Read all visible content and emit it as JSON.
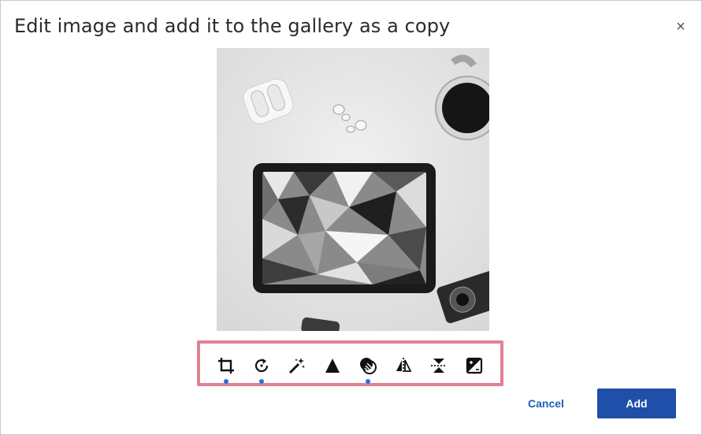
{
  "dialog": {
    "title": "Edit image and add it to the gallery as a copy",
    "close_label": "×"
  },
  "image": {
    "subject": "tablet-earbuds-coffee-flatlay"
  },
  "toolbar": {
    "tools": [
      {
        "icon": "crop-icon",
        "active": true
      },
      {
        "icon": "rotate-icon",
        "active": true
      },
      {
        "icon": "magic-wand-icon",
        "active": false
      },
      {
        "icon": "sharpen-triangle-icon",
        "active": false
      },
      {
        "icon": "filter-icon",
        "active": true
      },
      {
        "icon": "flip-horizontal-icon",
        "active": false
      },
      {
        "icon": "flip-vertical-icon",
        "active": false
      },
      {
        "icon": "exposure-icon",
        "active": false
      }
    ],
    "highlight_color": "#e27f92",
    "active_dot_color": "#1b74e4"
  },
  "actions": {
    "cancel_label": "Cancel",
    "add_label": "Add",
    "primary_color": "#1f4fa8"
  }
}
